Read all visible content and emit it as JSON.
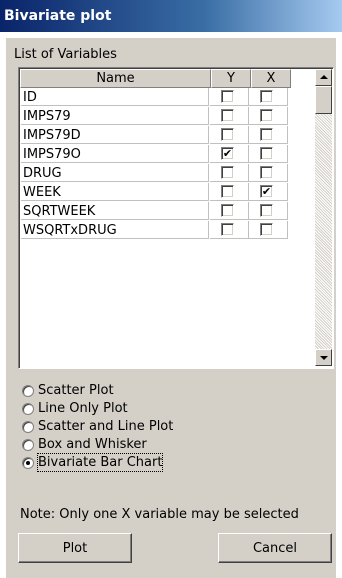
{
  "window": {
    "title": "Bivariate plot"
  },
  "list_label": "List of Variables",
  "columns": {
    "name": "Name",
    "y": "Y",
    "x": "X"
  },
  "variables": [
    {
      "name": "ID",
      "y": false,
      "x": false
    },
    {
      "name": "IMPS79",
      "y": false,
      "x": false
    },
    {
      "name": "IMPS79D",
      "y": false,
      "x": false
    },
    {
      "name": "IMPS79O",
      "y": true,
      "x": false
    },
    {
      "name": "DRUG",
      "y": false,
      "x": false
    },
    {
      "name": "WEEK",
      "y": false,
      "x": true
    },
    {
      "name": "SQRTWEEK",
      "y": false,
      "x": false
    },
    {
      "name": "WSQRTxDRUG",
      "y": false,
      "x": false
    }
  ],
  "plot_types": [
    {
      "label": "Scatter Plot",
      "selected": false
    },
    {
      "label": "Line Only Plot",
      "selected": false
    },
    {
      "label": "Scatter and Line Plot",
      "selected": false
    },
    {
      "label": "Box and Whisker",
      "selected": false
    },
    {
      "label": "Bivariate Bar Chart",
      "selected": true
    }
  ],
  "note": "Note: Only one X variable may be selected",
  "buttons": {
    "plot": "Plot",
    "cancel": "Cancel"
  },
  "icons": {
    "check": "✔"
  }
}
